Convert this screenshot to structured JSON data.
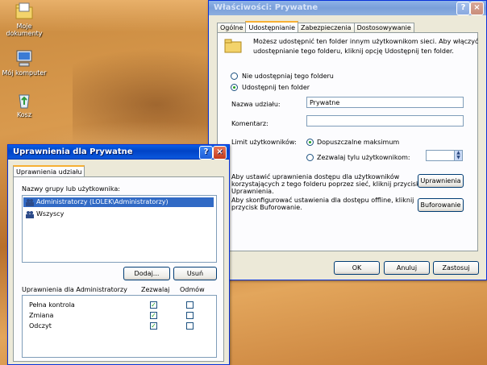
{
  "desktop": {
    "icons": [
      {
        "label_line1": "Moje",
        "label_line2": "dokumenty"
      },
      {
        "label": "Mój komputer"
      },
      {
        "label": "Kosz"
      }
    ]
  },
  "props": {
    "title": "Właściwości: Prywatne",
    "tabs": [
      "Ogólne",
      "Udostępnianie",
      "Zabezpieczenia",
      "Dostosowywanie"
    ],
    "intro_line1": "Możesz udostępnić ten folder innym użytkownikom sieci. Aby włączyć",
    "intro_line2": "udostępnianie tego folderu, kliknij opcję Udostępnij ten folder.",
    "radio_no_share": "Nie udostępniaj tego folderu",
    "radio_share": "Udostępnij ten folder",
    "share_name_label": "Nazwa udziału:",
    "share_name_value": "Prywatne",
    "comment_label": "Komentarz:",
    "comment_value": "",
    "user_limit_label": "Limit użytkowników:",
    "radio_max": "Dopuszczalne maksimum",
    "radio_allow": "Zezwalaj tylu użytkownikom:",
    "perm_text_1": "Aby ustawić uprawnienia dostępu dla użytkowników",
    "perm_text_2": "korzystających z tego folderu poprzez sieć, kliknij przycisk",
    "perm_text_3": "Uprawnienia.",
    "perm_button": "Uprawnienia",
    "offline_text_1": "Aby skonfigurować ustawienia dla dostępu offline, kliknij",
    "offline_text_2": "przycisk Buforowanie.",
    "cache_button": "Buforowanie",
    "ok": "OK",
    "cancel": "Anuluj",
    "apply": "Zastosuj"
  },
  "perm": {
    "title": "Uprawnienia dla Prywatne",
    "tab": "Uprawnienia udziału",
    "group_label": "Nazwy grupy lub użytkownika:",
    "users": [
      "Administratorzy (LOLEK\\Administratorzy)",
      "Wszyscy"
    ],
    "add": "Dodaj...",
    "remove": "Usuń",
    "perms_for": "Uprawnienia dla Administratorzy",
    "col_allow": "Zezwalaj",
    "col_deny": "Odmów",
    "rows": [
      {
        "name": "Pełna kontrola",
        "allow": true,
        "deny": false
      },
      {
        "name": "Zmiana",
        "allow": true,
        "deny": false
      },
      {
        "name": "Odczyt",
        "allow": true,
        "deny": false
      }
    ]
  }
}
